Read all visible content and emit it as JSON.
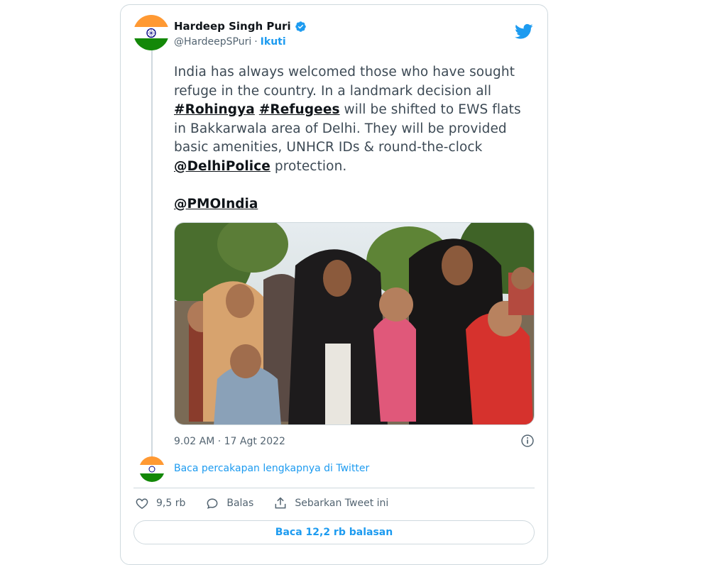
{
  "author": {
    "display_name": "Hardeep Singh Puri",
    "handle": "@HardeepSPuri",
    "separator": "·",
    "follow_label": "Ikuti"
  },
  "tweet": {
    "segments": [
      {
        "text": "India has always welcomed those who have sought refuge in the country. In a landmark decision all ",
        "tag": false
      },
      {
        "text": "#Rohingya",
        "tag": true
      },
      {
        "text": " ",
        "tag": false
      },
      {
        "text": "#Refugees",
        "tag": true
      },
      {
        "text": " will be shifted to EWS flats in Bakkarwala area of Delhi. They will be provided basic amenities, UNHCR IDs & round-the-clock ",
        "tag": false
      },
      {
        "text": "@DelhiPolice",
        "tag": true
      },
      {
        "text": " protection.",
        "tag": false
      }
    ],
    "mention": "@PMOIndia",
    "timestamp": "9.02 AM · 17 Agt 2022"
  },
  "thread": {
    "link_text": "Baca percakapan lengkapnya di Twitter"
  },
  "actions": {
    "likes": "9,5 rb",
    "reply_label": "Balas",
    "share_label": "Sebarkan Tweet ini"
  },
  "read_replies_label": "Baca 12,2 rb balasan",
  "colors": {
    "twitter_blue": "#1d9bf0",
    "flag_saffron": "#ff9933",
    "flag_green": "#138808",
    "chakra_navy": "#000080"
  },
  "icons": {
    "verified": "verified-badge-icon",
    "logo": "twitter-bird-icon",
    "info": "info-icon",
    "like": "heart-icon",
    "reply": "speech-bubble-icon",
    "share": "share-upload-icon"
  }
}
